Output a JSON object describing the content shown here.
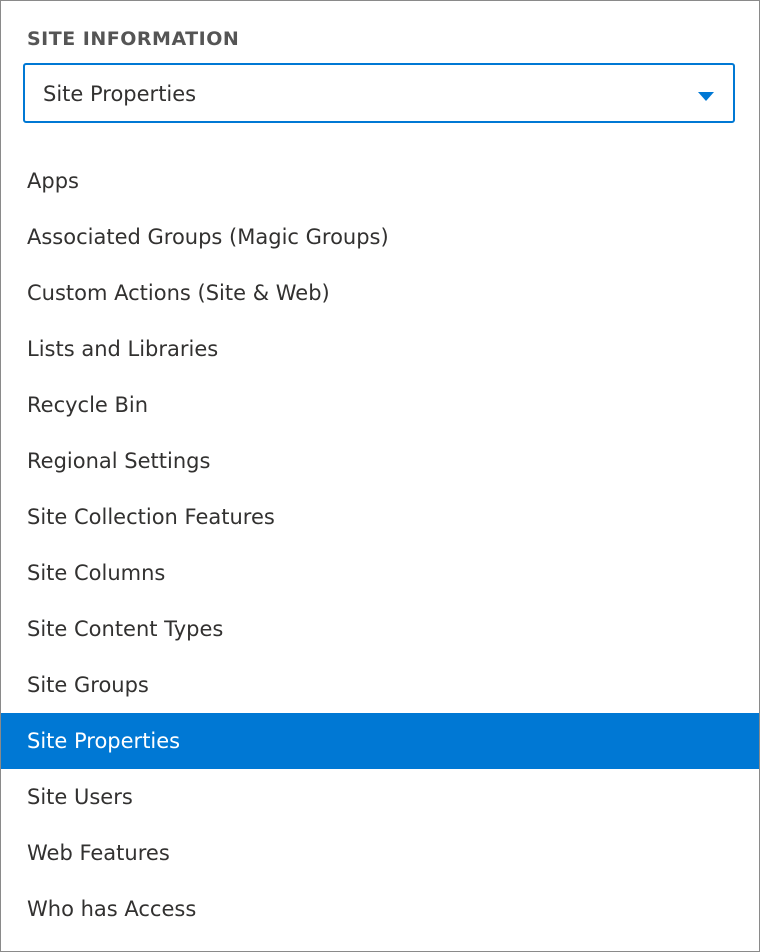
{
  "section": {
    "title": "SITE INFORMATION"
  },
  "dropdown": {
    "selected": "Site Properties",
    "chevron_icon": "caret-down-icon"
  },
  "options": [
    {
      "label": "Apps",
      "selected": false
    },
    {
      "label": "Associated Groups (Magic Groups)",
      "selected": false
    },
    {
      "label": "Custom Actions (Site & Web)",
      "selected": false
    },
    {
      "label": "Lists and Libraries",
      "selected": false
    },
    {
      "label": "Recycle Bin",
      "selected": false
    },
    {
      "label": "Regional Settings",
      "selected": false
    },
    {
      "label": "Site Collection Features",
      "selected": false
    },
    {
      "label": "Site Columns",
      "selected": false
    },
    {
      "label": "Site Content Types",
      "selected": false
    },
    {
      "label": "Site Groups",
      "selected": false
    },
    {
      "label": "Site Properties",
      "selected": true
    },
    {
      "label": "Site Users",
      "selected": false
    },
    {
      "label": "Web Features",
      "selected": false
    },
    {
      "label": "Who has Access",
      "selected": false
    }
  ],
  "colors": {
    "accent": "#0078d4",
    "text": "#323130",
    "header_text": "#555555",
    "selected_text": "#ffffff"
  }
}
